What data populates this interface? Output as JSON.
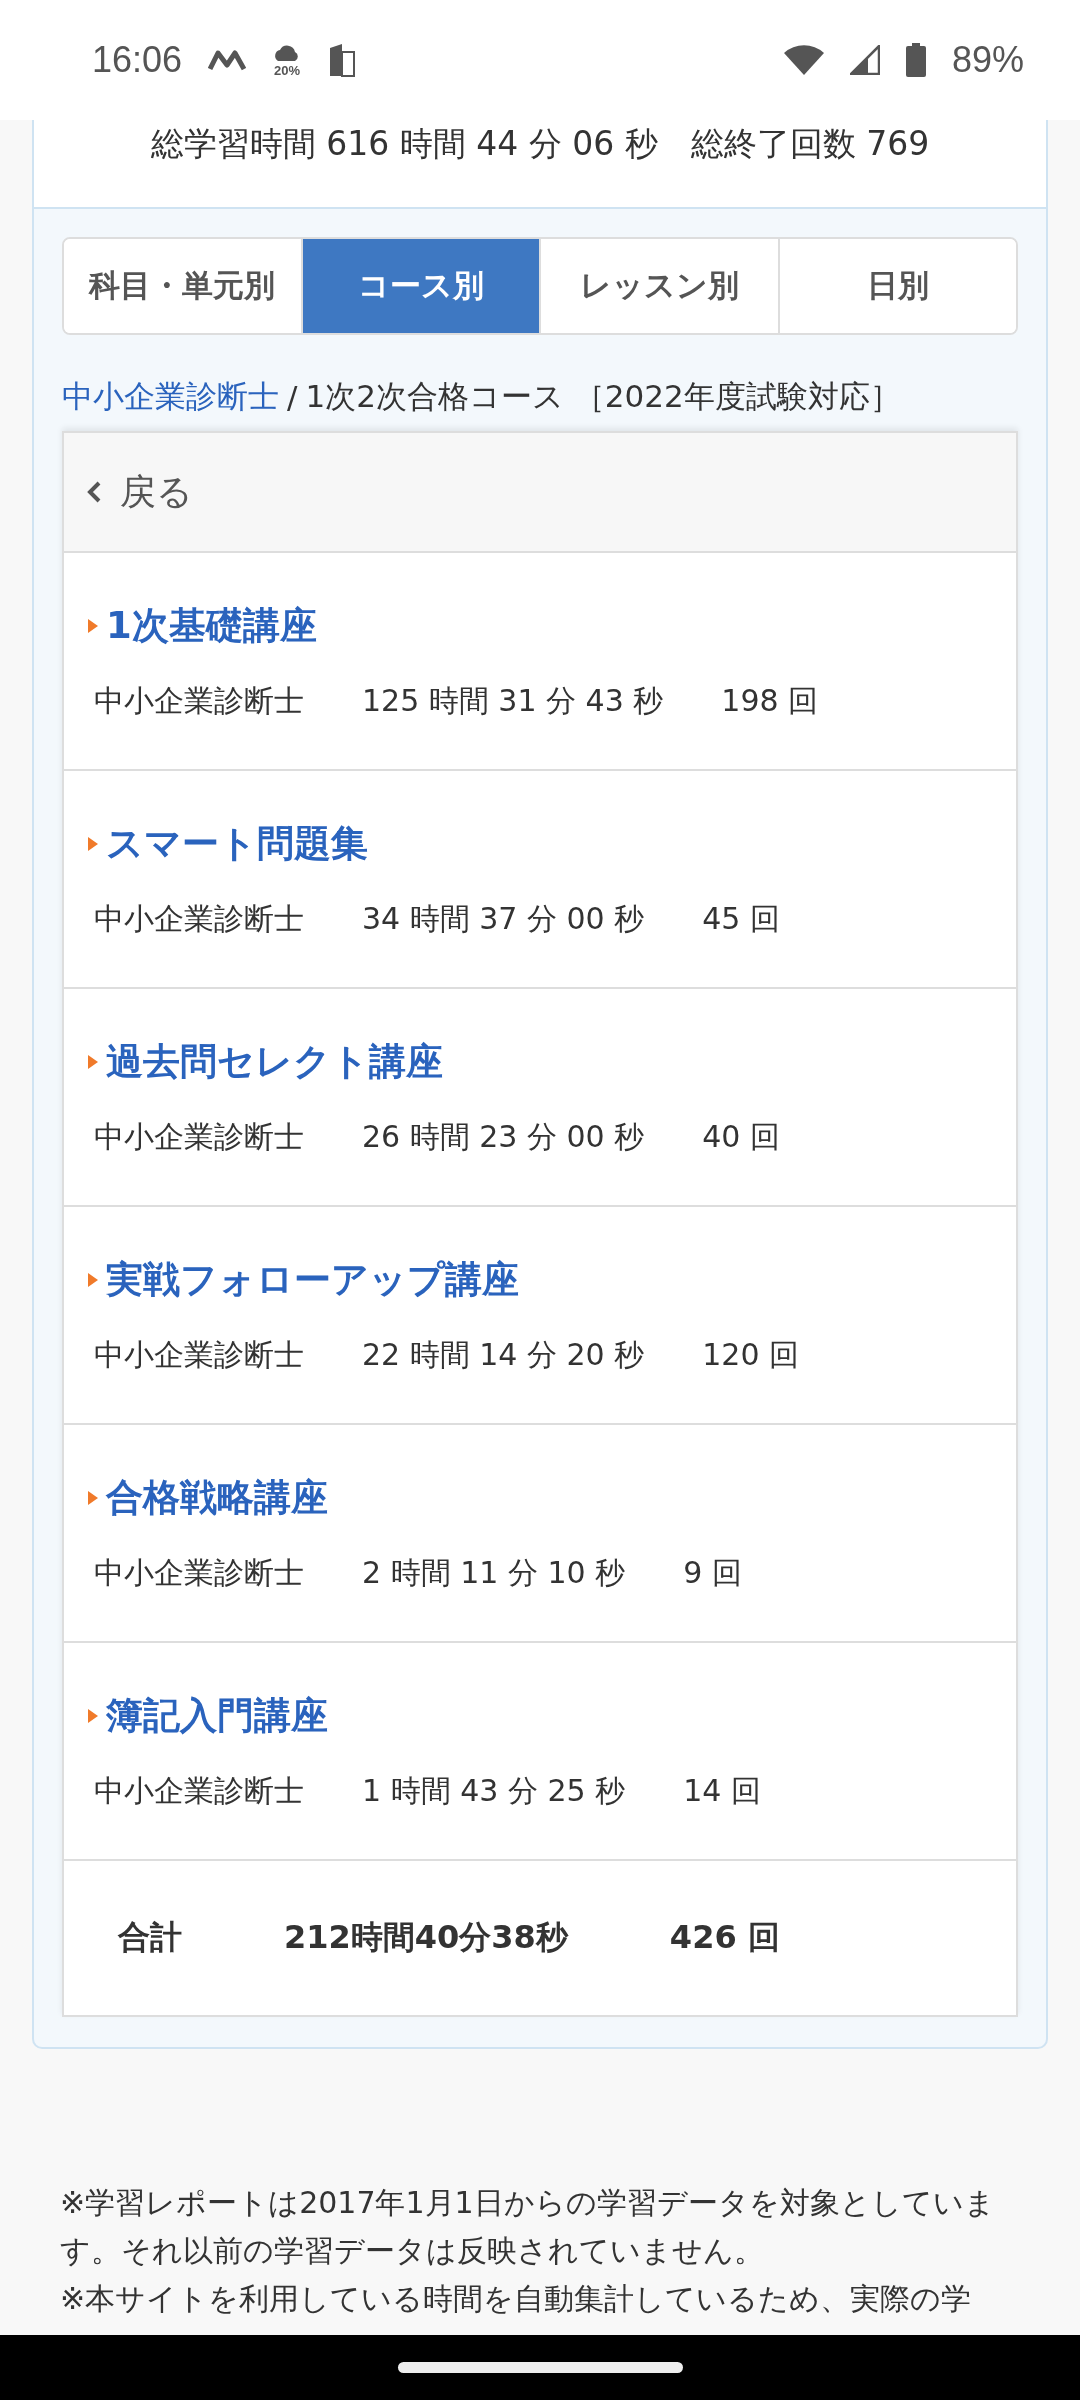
{
  "status_bar": {
    "time": "16:06",
    "weather_chance": "20%",
    "battery": "89%"
  },
  "summary": {
    "total_time_label": "総学習時間",
    "total_time": "616 時間 44 分 06 秒",
    "total_count_label": "総終了回数",
    "total_count": "769"
  },
  "tabs": [
    {
      "label": "科目・単元別",
      "selected": false
    },
    {
      "label": "コース別",
      "selected": true
    },
    {
      "label": "レッスン別",
      "selected": false
    },
    {
      "label": "日別",
      "selected": false
    }
  ],
  "breadcrumb": {
    "link": "中小企業診断士",
    "separator": "/",
    "current": "1次2次合格コース ［2022年度試験対応］"
  },
  "back_button": "戻る",
  "courses": [
    {
      "title": "1次基礎講座",
      "subject": "中小企業診断士",
      "time": "125 時間 31 分 43 秒",
      "count": "198 回"
    },
    {
      "title": "スマート問題集",
      "subject": "中小企業診断士",
      "time": "34 時間 37 分 00 秒",
      "count": "45 回"
    },
    {
      "title": "過去問セレクト講座",
      "subject": "中小企業診断士",
      "time": "26 時間 23 分 00 秒",
      "count": "40 回"
    },
    {
      "title": "実戦フォローアップ講座",
      "subject": "中小企業診断士",
      "time": "22 時間 14 分 20 秒",
      "count": "120 回"
    },
    {
      "title": "合格戦略講座",
      "subject": "中小企業診断士",
      "time": "2 時間 11 分 10 秒",
      "count": "9 回"
    },
    {
      "title": "簿記入門講座",
      "subject": "中小企業診断士",
      "time": "1 時間 43 分 25 秒",
      "count": "14 回"
    }
  ],
  "total": {
    "label": "合計",
    "time": "212時間40分38秒",
    "count": "426 回"
  },
  "notes": [
    "※学習レポートは2017年1月1日からの学習データを対象としています。それ以前の学習データは反映されていません。",
    "※本サイトを利用している時間を自動集計しているため、実際の学"
  ]
}
